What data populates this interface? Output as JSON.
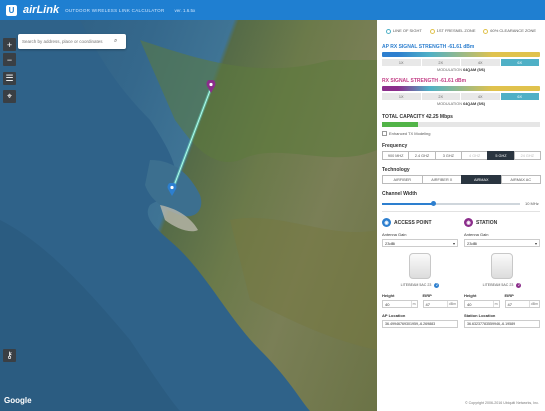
{
  "app": {
    "logo_letter": "U",
    "brand": "airLink",
    "subtitle": "OUTDOOR WIRELESS LINK CALCULATOR",
    "version": "ver. 1.6.5x"
  },
  "map": {
    "search_placeholder": "Search by address, place or coordinates",
    "zoom_in": "+",
    "zoom_out": "−",
    "google_label": "Google"
  },
  "legend": {
    "line_of_sight": "LINE OF SIGHT",
    "fresnel": "1ST FRESNEL ZONE",
    "clearance": "60% CLEARANCE ZONE"
  },
  "ap_signal": {
    "label": "AP RX SIGNAL STRENGTH",
    "value": "-61.61 dBm",
    "levels": [
      "1X",
      "2X",
      "4X",
      "6X"
    ],
    "active_level": "6X",
    "modulation_label": "MODULATION",
    "modulation_value": "64QAM (5/6)"
  },
  "station_signal": {
    "label": "RX SIGNAL STRENGTH",
    "value": "-61.61 dBm",
    "levels": [
      "1X",
      "2X",
      "4X",
      "6X"
    ],
    "active_level": "6X",
    "modulation_label": "MODULATION",
    "modulation_value": "64QAM (5/6)"
  },
  "capacity": {
    "label": "TOTAL CAPACITY",
    "value": "42.25 Mbps",
    "fill_fraction": 0.23,
    "enhanced_label": "Enhanced TX Modeling"
  },
  "frequency": {
    "label": "Frequency",
    "options": [
      "900 MHZ",
      "2.4 GHZ",
      "3 GHZ",
      "4 GHZ",
      "5 GHZ",
      "24 GHZ"
    ],
    "active": "5 GHZ",
    "dim": [
      "4 GHZ",
      "24 GHZ"
    ]
  },
  "technology": {
    "label": "Technology",
    "options": [
      "AIRFIBER",
      "AIRFIBER X",
      "AIRMAX",
      "AIRMAX AC"
    ],
    "active": "AIRMAX"
  },
  "channel": {
    "label": "Channel Width",
    "value": "10 MHz",
    "fraction": 0.37
  },
  "access_point": {
    "title": "ACCESS POINT",
    "gain_label": "Antenna Gain",
    "gain_value": "23dBi",
    "device_name": "LITEBEAM 5AC 23",
    "badge": "2",
    "height_label": "Height",
    "height_value": "40",
    "height_unit": "m",
    "eirp_label": "EIRP",
    "eirp_value": "47",
    "eirp_unit": "dBm",
    "location_label": "AP Location",
    "location_value": "36.49946769301959,-6.269883"
  },
  "station": {
    "title": "STATION",
    "gain_label": "Antenna Gain",
    "gain_value": "23dBi",
    "device_name": "LITEBEAM 5AC 23",
    "badge": "2",
    "height_label": "Height",
    "height_value": "40",
    "height_unit": "m",
    "eirp_label": "EIRP",
    "eirp_value": "47",
    "eirp_unit": "dBm",
    "location_label": "Station Location",
    "location_value": "36.63237783559946,-6.19589"
  },
  "footer": {
    "copyright": "© Copyright 2006-2016 Ubiquiti Networks, Inc."
  },
  "colors": {
    "accent": "#1f7fd1",
    "ap": "#2d7fcf",
    "station": "#8b2d8b",
    "signal_good": "#4fb0c6",
    "capacity": "#52b448"
  }
}
